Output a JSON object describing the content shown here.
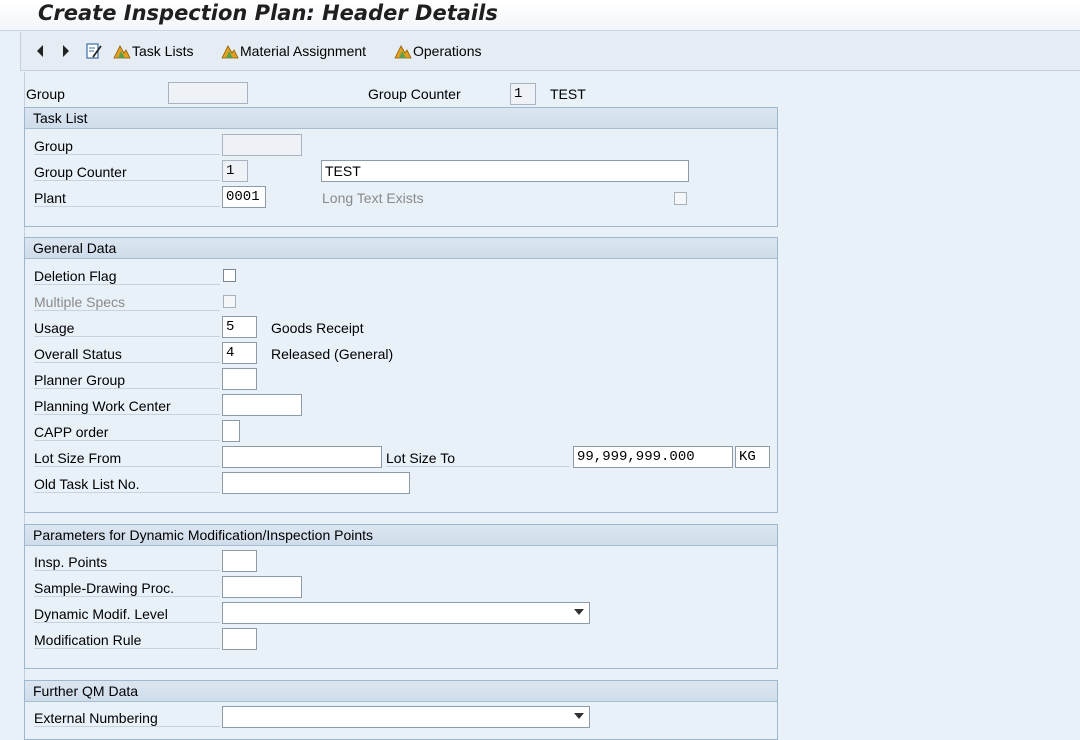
{
  "window": {
    "title": "Create Inspection Plan: Header Details"
  },
  "toolbar": {
    "back_icon": "triangle-left-icon",
    "forward_icon": "triangle-right-icon",
    "task_lists": "Task Lists",
    "material_assignment": "Material Assignment",
    "operations": "Operations"
  },
  "header": {
    "group_label": "Group",
    "group_value": "",
    "group_counter_label": "Group Counter",
    "group_counter_value": "1",
    "group_counter_text": "TEST"
  },
  "task_list": {
    "title": "Task List",
    "group_label": "Group",
    "group_value": "",
    "group_counter_label": "Group Counter",
    "group_counter_value": "1",
    "description_value": "TEST",
    "plant_label": "Plant",
    "plant_value": "0001",
    "long_text_label": "Long Text Exists"
  },
  "general_data": {
    "title": "General Data",
    "deletion_flag_label": "Deletion Flag",
    "multiple_specs_label": "Multiple Specs",
    "usage_label": "Usage",
    "usage_value": "5",
    "usage_text": "Goods Receipt",
    "overall_status_label": "Overall Status",
    "overall_status_value": "4",
    "overall_status_text": "Released (General)",
    "planner_group_label": "Planner Group",
    "planning_work_center_label": "Planning Work Center",
    "capp_order_label": "CAPP order",
    "lot_size_from_label": "Lot Size From",
    "lot_size_to_label": "Lot Size To",
    "lot_size_to_value": "99,999,999.000",
    "unit_value": "KG",
    "old_task_list_label": "Old Task List No."
  },
  "dynamic_mod": {
    "title": "Parameters for Dynamic Modification/Inspection Points",
    "insp_points_label": "Insp. Points",
    "sample_drawing_label": "Sample-Drawing Proc.",
    "dynamic_modif_level_label": "Dynamic Modif. Level",
    "modification_rule_label": "Modification Rule"
  },
  "further_qm": {
    "title": "Further QM Data",
    "external_numbering_label": "External Numbering"
  },
  "colors": {
    "background": "#e8f0f8",
    "group_border": "#9fb6cc",
    "disabled_text": "#8a8a8a"
  }
}
